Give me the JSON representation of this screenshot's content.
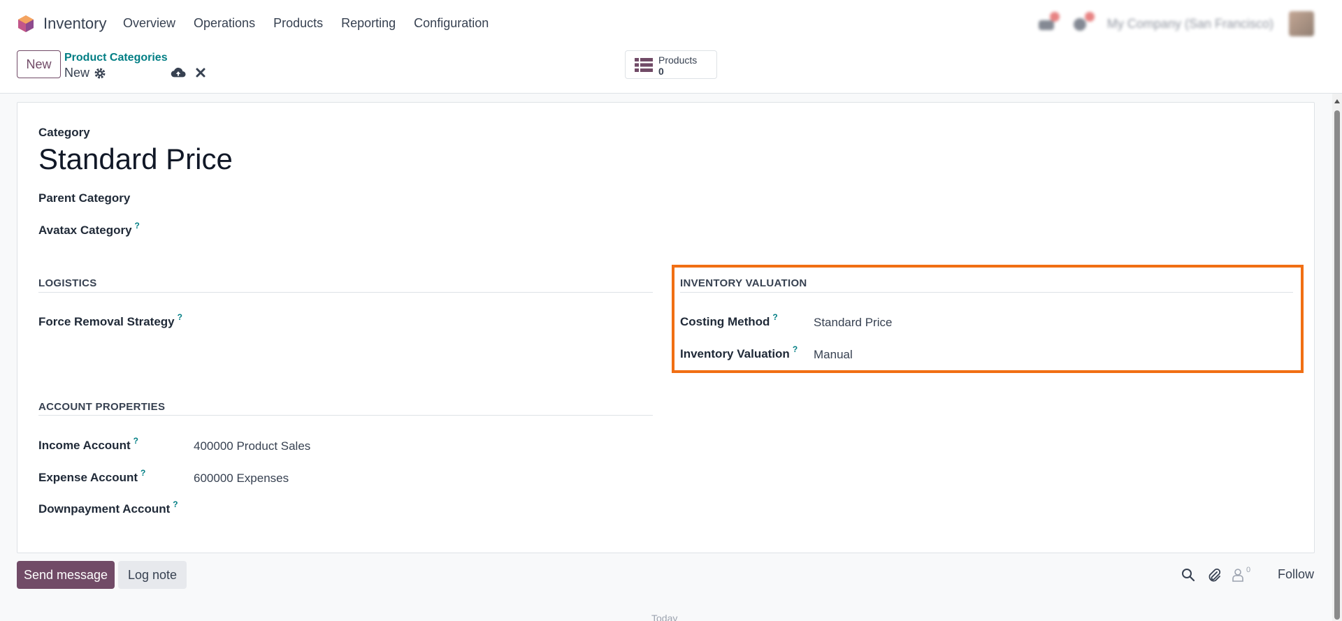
{
  "nav": {
    "app_name": "Inventory",
    "menu": [
      "Overview",
      "Operations",
      "Products",
      "Reporting",
      "Configuration"
    ],
    "company": "My Company (San Francisco)"
  },
  "control": {
    "new_label": "New",
    "breadcrumb_parent": "Product Categories",
    "breadcrumb_current": "New",
    "smart_button": {
      "label": "Products",
      "count": "0"
    }
  },
  "form": {
    "category_label": "Category",
    "category_name": "Standard Price",
    "parent_category_label": "Parent Category",
    "avatax_label": "Avatax Category",
    "help_mark": "?",
    "logistics": {
      "title": "LOGISTICS",
      "force_removal_label": "Force Removal Strategy"
    },
    "valuation": {
      "title": "INVENTORY VALUATION",
      "costing_method_label": "Costing Method",
      "costing_method_value": "Standard Price",
      "inventory_valuation_label": "Inventory Valuation",
      "inventory_valuation_value": "Manual"
    },
    "accounts": {
      "title": "ACCOUNT PROPERTIES",
      "income_label": "Income Account",
      "income_value": "400000 Product Sales",
      "expense_label": "Expense Account",
      "expense_value": "600000 Expenses",
      "downpayment_label": "Downpayment Account"
    }
  },
  "chatter": {
    "send_message": "Send message",
    "log_note": "Log note",
    "followers_count": "0",
    "follow": "Follow",
    "today": "Today"
  },
  "colors": {
    "brand": "#714b67",
    "link": "#017e84",
    "highlight": "#f16f14"
  }
}
